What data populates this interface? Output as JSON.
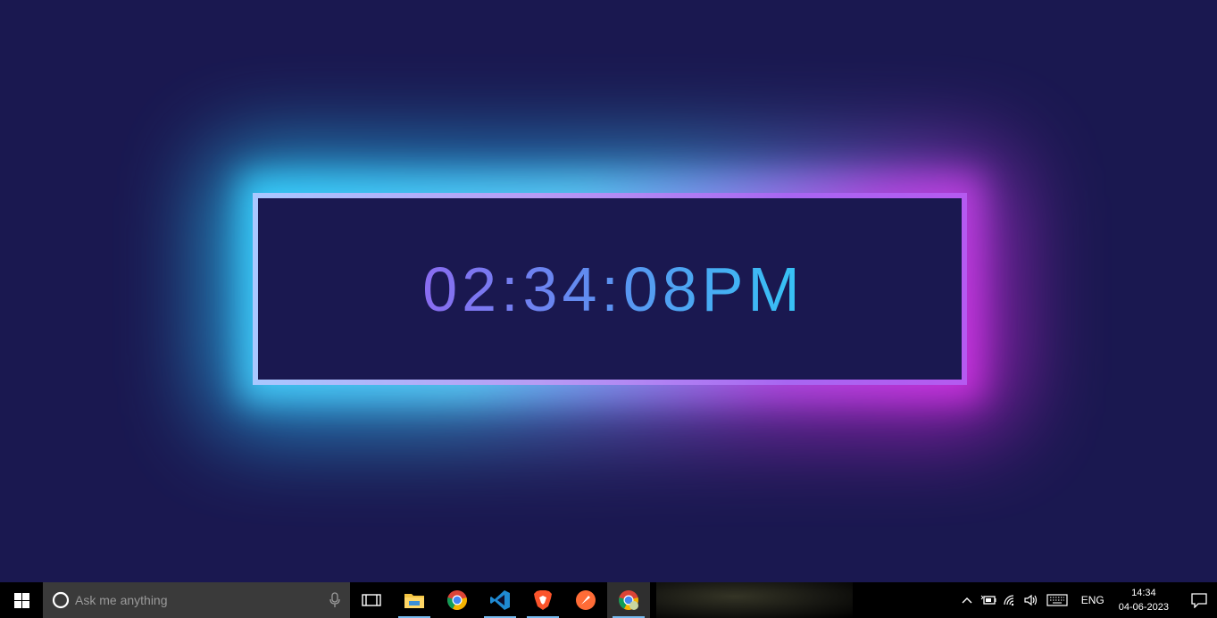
{
  "clock": {
    "time": "02:34:08PM"
  },
  "taskbar": {
    "search_placeholder": "Ask me anything",
    "apps": [
      {
        "name": "task-view-icon"
      },
      {
        "name": "file-explorer-icon"
      },
      {
        "name": "chrome-icon"
      },
      {
        "name": "vscode-icon"
      },
      {
        "name": "brave-icon"
      },
      {
        "name": "postman-icon"
      },
      {
        "name": "chrome-profile-icon"
      }
    ],
    "tray": {
      "language": "ENG",
      "time": "14:34",
      "date": "04-06-2023"
    }
  },
  "colors": {
    "background": "#1a1850",
    "glow_cyan": "#29c6f2",
    "glow_magenta": "#c020d0",
    "frame_start": "#a9c8ff",
    "frame_end": "#b55af0",
    "text_start": "#8a6cf0",
    "text_end": "#35c4f5",
    "taskbar_active": "#76b9ed"
  }
}
